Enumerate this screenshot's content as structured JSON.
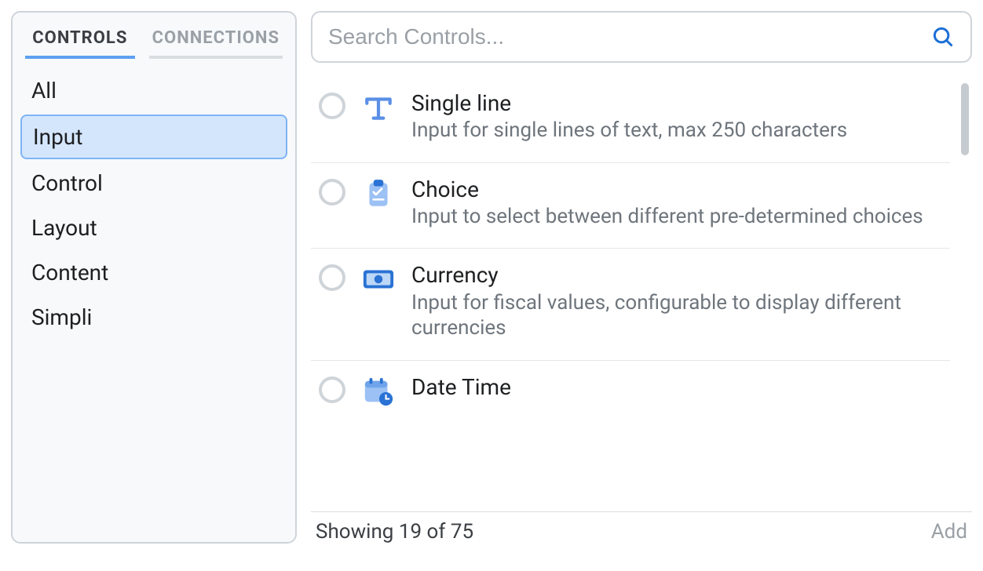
{
  "sidebar": {
    "tabs": [
      {
        "label": "CONTROLS",
        "active": true
      },
      {
        "label": "CONNECTIONS",
        "active": false
      }
    ],
    "items": [
      {
        "label": "All",
        "selected": false
      },
      {
        "label": "Input",
        "selected": true
      },
      {
        "label": "Control",
        "selected": false
      },
      {
        "label": "Layout",
        "selected": false
      },
      {
        "label": "Content",
        "selected": false
      },
      {
        "label": "Simpli",
        "selected": false
      }
    ]
  },
  "search": {
    "placeholder": "Search Controls..."
  },
  "rows": [
    {
      "icon": "text",
      "title": "Single line",
      "desc": "Input for single lines of text, max 250 characters"
    },
    {
      "icon": "clipboard",
      "title": "Choice",
      "desc": "Input to select between different pre-determined choices"
    },
    {
      "icon": "currency",
      "title": "Currency",
      "desc": "Input for fiscal values, configurable to display different currencies"
    },
    {
      "icon": "datetime",
      "title": "Date Time",
      "desc": ""
    }
  ],
  "footer": {
    "status": "Showing 19 of 75",
    "add_label": "Add"
  }
}
